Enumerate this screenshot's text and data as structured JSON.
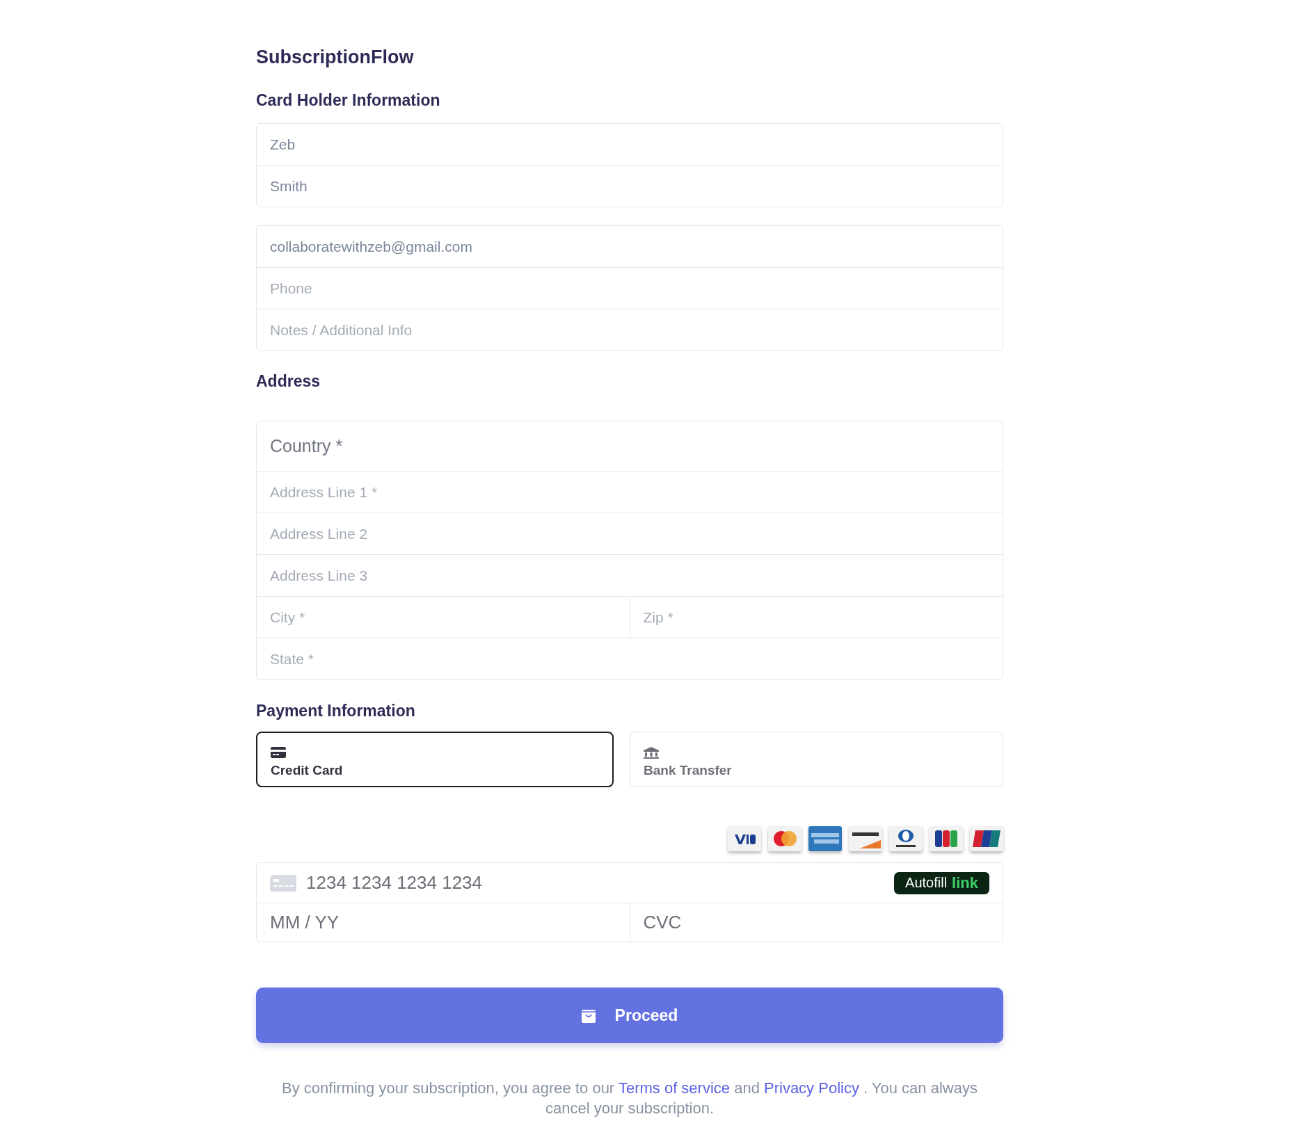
{
  "title": "SubscriptionFlow",
  "sections": [
    {
      "heading": "Card Holder Information",
      "groups": [
        {
          "fields": [
            {
              "kind": "input",
              "value": "Zeb"
            },
            {
              "kind": "input",
              "value": "Smith"
            }
          ]
        },
        {
          "fields": [
            {
              "kind": "input",
              "value": "collaboratewithzeb@gmail.com"
            },
            {
              "kind": "input",
              "placeholder": "Phone"
            },
            {
              "kind": "input",
              "placeholder": "Notes / Additional Info"
            }
          ]
        }
      ]
    },
    {
      "heading": "Address",
      "groups": [
        {
          "fields": [
            {
              "kind": "select",
              "placeholder": "Country *"
            },
            {
              "kind": "input",
              "placeholder": "Address Line 1 *"
            },
            {
              "kind": "input",
              "placeholder": "Address Line 2"
            },
            {
              "kind": "input",
              "placeholder": "Address Line 3"
            },
            {
              "kind": "pair",
              "fields": [
                {
                  "kind": "input",
                  "placeholder": "City *"
                },
                {
                  "kind": "input",
                  "placeholder": "Zip *"
                }
              ]
            },
            {
              "kind": "input",
              "placeholder": "State *"
            }
          ]
        }
      ]
    }
  ],
  "payment": {
    "heading": "Payment Information",
    "methods": [
      {
        "kind": "card",
        "label": "Credit Card",
        "selected": true
      },
      {
        "kind": "bank",
        "label": "Bank Transfer",
        "selected": false
      }
    ],
    "card_number": {
      "placeholder": "1234 1234 1234 1234"
    },
    "autofill": {
      "label": "Autofill",
      "brand": "link"
    },
    "expiry": {
      "placeholder": "MM / YY"
    },
    "cvc": {
      "placeholder": "CVC"
    }
  },
  "proceed": {
    "label": "Proceed"
  },
  "footer": [
    {
      "kind": "text",
      "text": "By confirming your subscription, you agree to our "
    },
    {
      "kind": "link",
      "text": "Terms of service"
    },
    {
      "kind": "text",
      "text": " and "
    },
    {
      "kind": "link",
      "text": "Privacy Policy"
    },
    {
      "kind": "text",
      "text": " . You can always cancel your subscription."
    }
  ]
}
